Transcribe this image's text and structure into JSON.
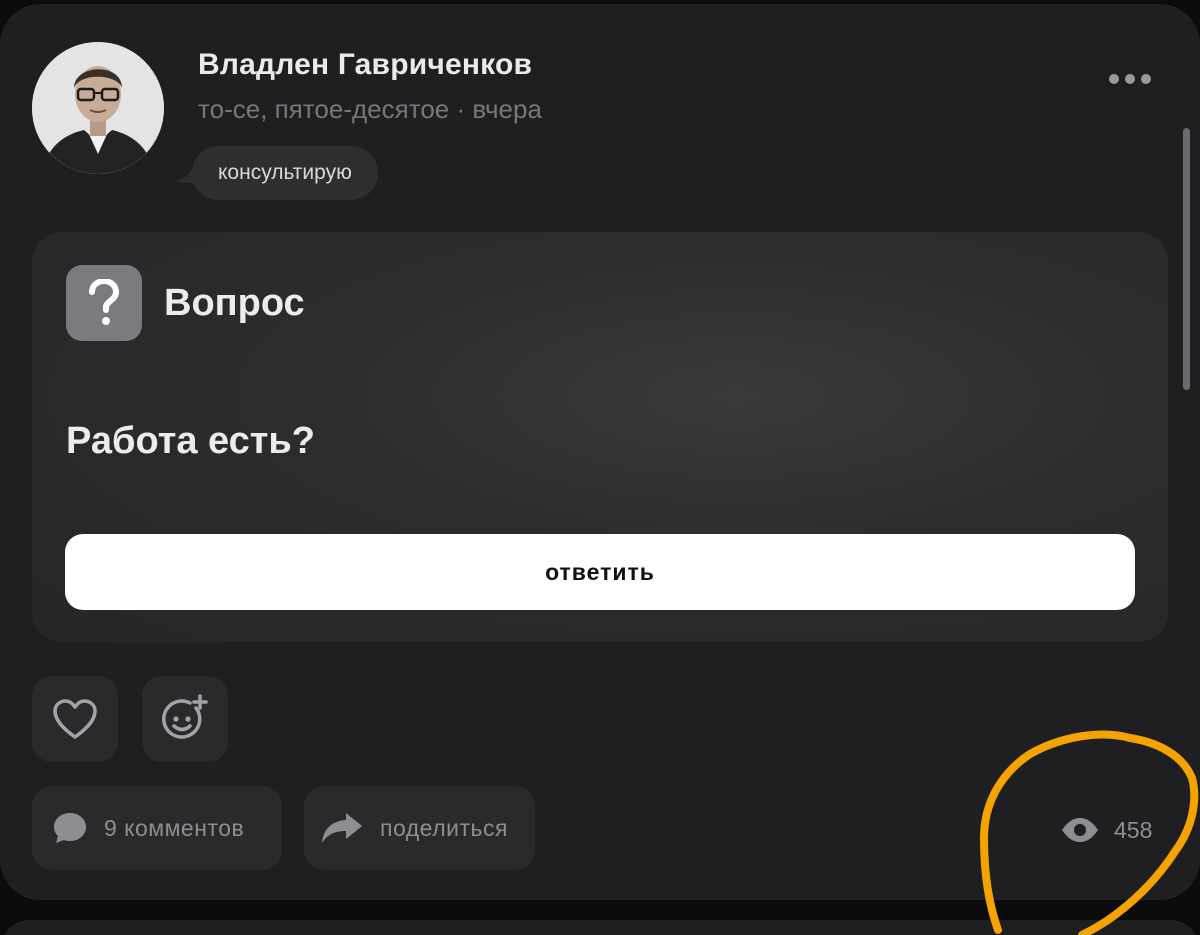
{
  "post": {
    "author": {
      "name": "Владлен Гавриченков",
      "meta": "то-се, пятое-десятое · вчера",
      "status": "консультирую"
    },
    "question": {
      "label": "Вопрос",
      "text": "Работа есть?",
      "answer_button": "ответить"
    },
    "actions": {
      "comments_label": "9 комментов",
      "share_label": "поделиться",
      "views": "458"
    }
  },
  "colors": {
    "background": "#0c0c0d",
    "card": "#1f1f21",
    "accent_annotation": "#f5a300",
    "button_primary": "#ffffff"
  },
  "icons": [
    "more-icon",
    "question-mark-icon",
    "heart-icon",
    "emoji-add-icon",
    "comment-icon",
    "share-icon",
    "eye-icon"
  ]
}
